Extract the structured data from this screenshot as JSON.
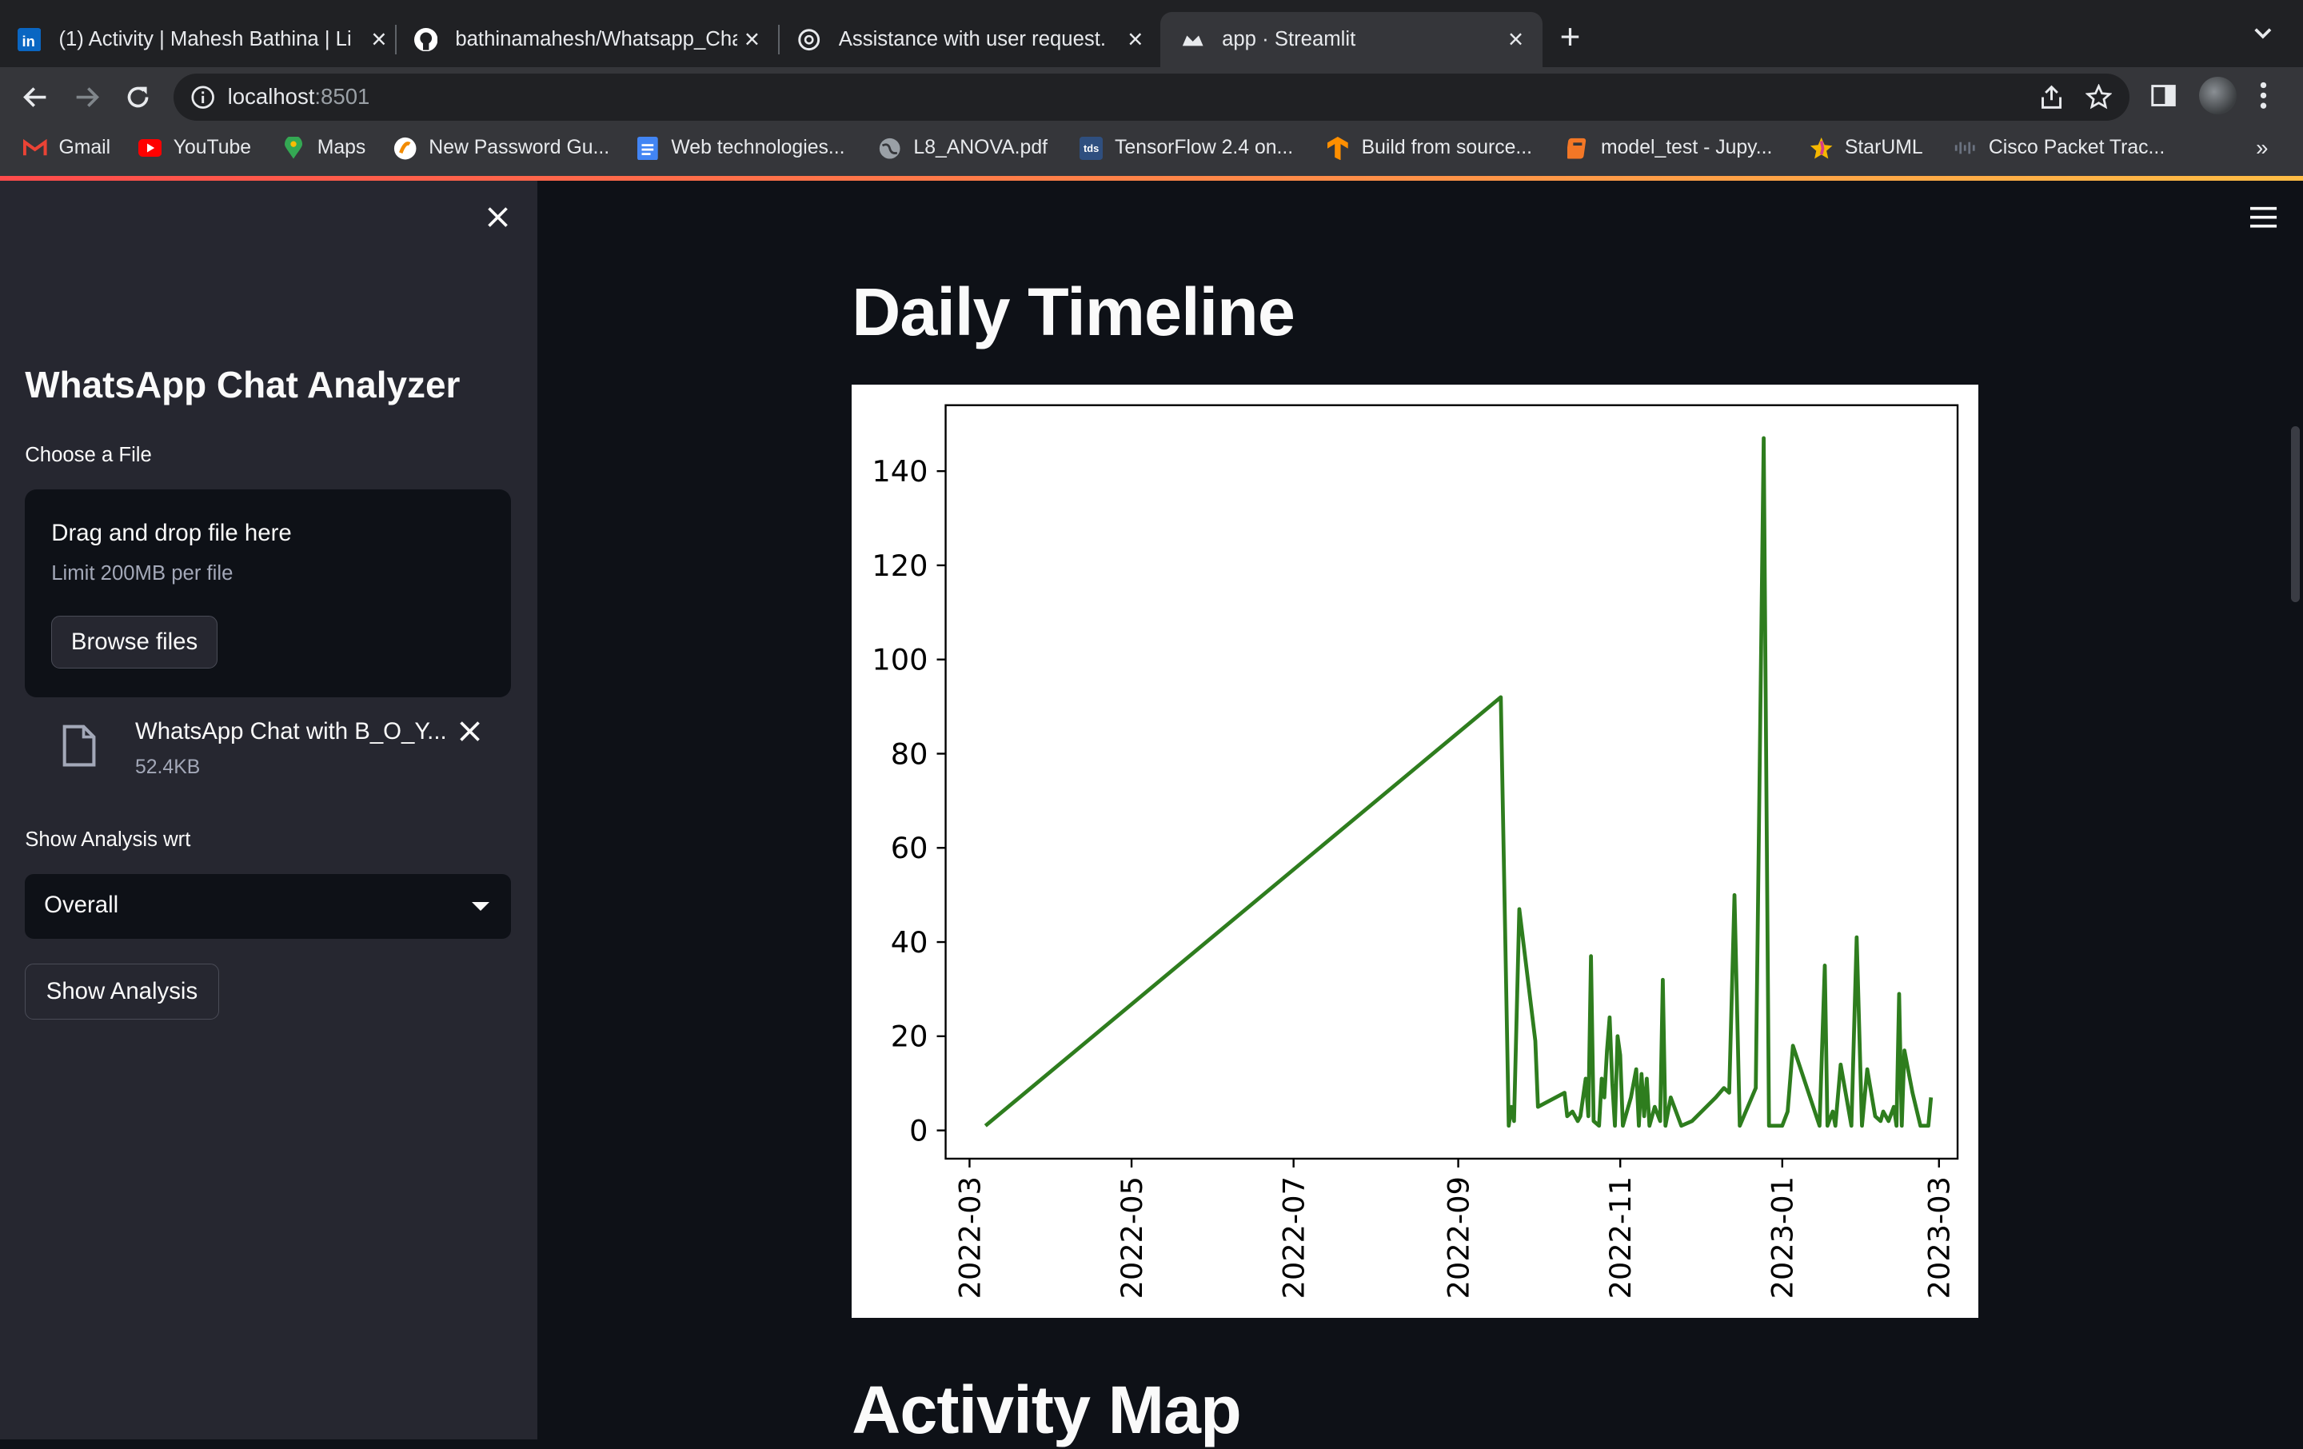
{
  "browser": {
    "tabs": [
      {
        "title": "(1) Activity | Mahesh Bathina | Li",
        "favicon": "linkedin-icon",
        "active": false
      },
      {
        "title": "bathinamahesh/Whatsapp_Cha",
        "favicon": "github-icon",
        "active": false
      },
      {
        "title": "Assistance with user request.",
        "favicon": "openai-icon",
        "active": false
      },
      {
        "title": "app · Streamlit",
        "favicon": "streamlit-icon",
        "active": true
      }
    ],
    "url_host": "localhost",
    "url_port": ":8501",
    "bookmarks": [
      {
        "label": "Gmail",
        "icon": "gmail-icon",
        "color": "#ea4335"
      },
      {
        "label": "YouTube",
        "icon": "youtube-icon",
        "color": "#ff0000"
      },
      {
        "label": "Maps",
        "icon": "maps-icon",
        "color": "#34a853"
      },
      {
        "label": "New Password Gu...",
        "icon": "password-icon",
        "color": "#f28b00"
      },
      {
        "label": "Web technologies...",
        "icon": "docs-icon",
        "color": "#4285f4"
      },
      {
        "label": "L8_ANOVA.pdf",
        "icon": "globe-icon",
        "color": "#9aa0a6"
      },
      {
        "label": "TensorFlow 2.4 on...",
        "icon": "tds-icon",
        "color": "#2f4f7f"
      },
      {
        "label": "Build from source...",
        "icon": "tensorflow-icon",
        "color": "#ff8f00"
      },
      {
        "label": "model_test - Jupy...",
        "icon": "jupyter-icon",
        "color": "#f37726"
      },
      {
        "label": "StarUML",
        "icon": "staruml-icon",
        "color": "#f5b700"
      },
      {
        "label": "Cisco Packet Trac...",
        "icon": "cisco-icon",
        "color": "#6b7280"
      }
    ]
  },
  "sidebar": {
    "title": "WhatsApp Chat Analyzer",
    "file_label": "Choose a File",
    "dropzone_title": "Drag and drop file here",
    "dropzone_limit": "Limit 200MB per file",
    "browse_label": "Browse files",
    "file_name": "WhatsApp Chat with B_O_Y...",
    "file_size": "52.4KB",
    "analysis_label": "Show Analysis wrt",
    "analysis_value": "Overall",
    "show_button": "Show Analysis"
  },
  "main": {
    "heading": "Daily Timeline",
    "next_heading": "Activity Map"
  },
  "chart_data": {
    "type": "line",
    "color": "#2e7d1e",
    "x_type": "date",
    "xlim": [
      "2022-02-20",
      "2023-03-08"
    ],
    "ylim": [
      -6,
      154
    ],
    "yticks": [
      0,
      20,
      40,
      60,
      80,
      100,
      120,
      140
    ],
    "xticks": [
      "2022-03",
      "2022-05",
      "2022-07",
      "2022-09",
      "2022-11",
      "2023-01",
      "2023-03"
    ],
    "points": [
      [
        "2022-03-07",
        1
      ],
      [
        "2022-09-17",
        92
      ],
      [
        "2022-09-20",
        1
      ],
      [
        "2022-09-21",
        5
      ],
      [
        "2022-09-22",
        2
      ],
      [
        "2022-09-24",
        47
      ],
      [
        "2022-09-30",
        19
      ],
      [
        "2022-10-01",
        5
      ],
      [
        "2022-10-11",
        8
      ],
      [
        "2022-10-12",
        3
      ],
      [
        "2022-10-14",
        4
      ],
      [
        "2022-10-16",
        2
      ],
      [
        "2022-10-17",
        3
      ],
      [
        "2022-10-19",
        11
      ],
      [
        "2022-10-20",
        3
      ],
      [
        "2022-10-21",
        37
      ],
      [
        "2022-10-22",
        2
      ],
      [
        "2022-10-24",
        1
      ],
      [
        "2022-10-25",
        11
      ],
      [
        "2022-10-26",
        7
      ],
      [
        "2022-10-27",
        17
      ],
      [
        "2022-10-28",
        24
      ],
      [
        "2022-10-29",
        10
      ],
      [
        "2022-10-30",
        1
      ],
      [
        "2022-10-31",
        20
      ],
      [
        "2022-11-01",
        16
      ],
      [
        "2022-11-02",
        1
      ],
      [
        "2022-11-05",
        7
      ],
      [
        "2022-11-07",
        13
      ],
      [
        "2022-11-08",
        1
      ],
      [
        "2022-11-09",
        12
      ],
      [
        "2022-11-10",
        3
      ],
      [
        "2022-11-11",
        11
      ],
      [
        "2022-11-12",
        1
      ],
      [
        "2022-11-14",
        5
      ],
      [
        "2022-11-16",
        2
      ],
      [
        "2022-11-17",
        32
      ],
      [
        "2022-11-18",
        1
      ],
      [
        "2022-11-20",
        7
      ],
      [
        "2022-11-24",
        1
      ],
      [
        "2022-11-28",
        2
      ],
      [
        "2022-12-07",
        7
      ],
      [
        "2022-12-10",
        9
      ],
      [
        "2022-12-12",
        8
      ],
      [
        "2022-12-14",
        50
      ],
      [
        "2022-12-16",
        1
      ],
      [
        "2022-12-22",
        9
      ],
      [
        "2022-12-25",
        147
      ],
      [
        "2022-12-27",
        1
      ],
      [
        "2023-01-01",
        1
      ],
      [
        "2023-01-03",
        4
      ],
      [
        "2023-01-05",
        18
      ],
      [
        "2023-01-15",
        1
      ],
      [
        "2023-01-17",
        35
      ],
      [
        "2023-01-18",
        1
      ],
      [
        "2023-01-20",
        4
      ],
      [
        "2023-01-21",
        1
      ],
      [
        "2023-01-23",
        14
      ],
      [
        "2023-01-27",
        1
      ],
      [
        "2023-01-29",
        41
      ],
      [
        "2023-01-31",
        1
      ],
      [
        "2023-02-02",
        13
      ],
      [
        "2023-02-05",
        3
      ],
      [
        "2023-02-07",
        2
      ],
      [
        "2023-02-08",
        4
      ],
      [
        "2023-02-10",
        2
      ],
      [
        "2023-02-12",
        5
      ],
      [
        "2023-02-13",
        1
      ],
      [
        "2023-02-14",
        29
      ],
      [
        "2023-02-15",
        1
      ],
      [
        "2023-02-16",
        17
      ],
      [
        "2023-02-19",
        8
      ],
      [
        "2023-02-22",
        1
      ],
      [
        "2023-02-25",
        1
      ],
      [
        "2023-02-26",
        7
      ]
    ]
  }
}
